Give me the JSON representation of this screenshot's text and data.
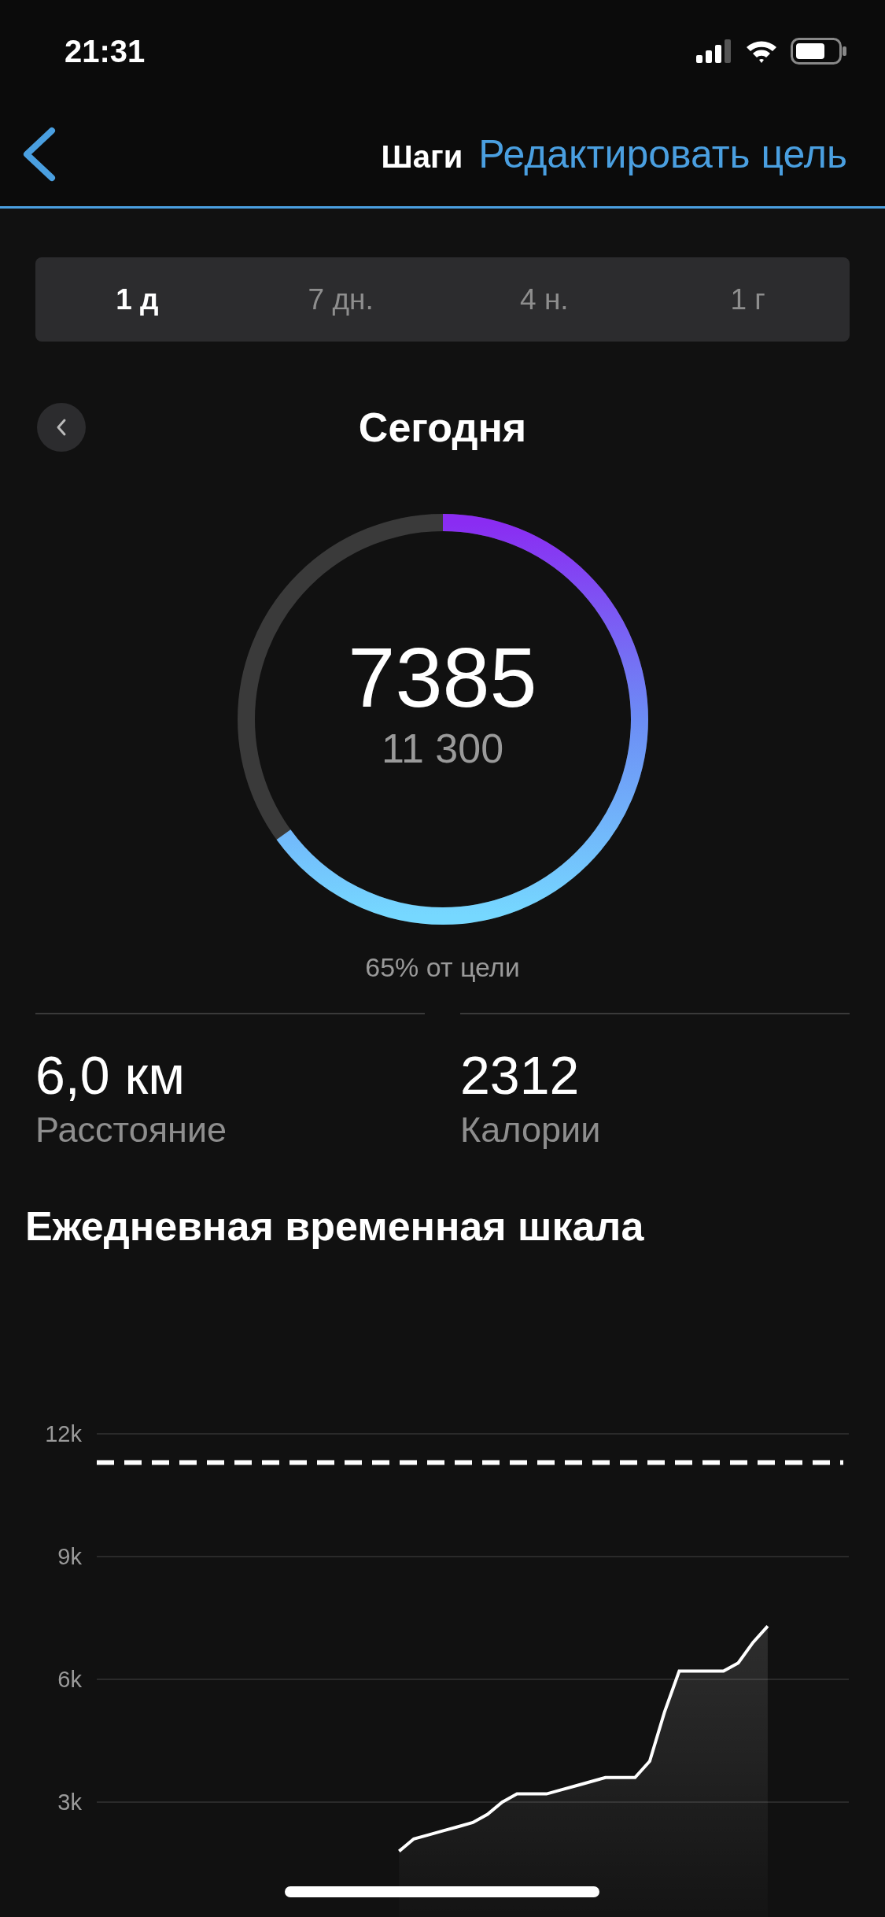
{
  "status_bar": {
    "time": "21:31"
  },
  "nav": {
    "title": "Шаги",
    "action": "Редактировать цель"
  },
  "tabs": [
    {
      "label": "1 д",
      "selected": true
    },
    {
      "label": "7 дн.",
      "selected": false
    },
    {
      "label": "4 н.",
      "selected": false
    },
    {
      "label": "1 г",
      "selected": false
    }
  ],
  "period": {
    "title": "Сегодня"
  },
  "ring": {
    "value": "7385",
    "goal": "11 300",
    "caption": "65% от цели"
  },
  "stats": [
    {
      "value": "6,0 км",
      "label": "Расстояние"
    },
    {
      "value": "2312",
      "label": "Калории"
    }
  ],
  "timeline": {
    "title": "Ежедневная временная шкала",
    "chart_data": {
      "type": "area",
      "ylim": [
        0,
        12000
      ],
      "yticks": [
        {
          "value": 3000,
          "label": "3k"
        },
        {
          "value": 6000,
          "label": "6k"
        },
        {
          "value": 9000,
          "label": "9k"
        },
        {
          "value": 12000,
          "label": "12k"
        }
      ],
      "categories": [
        null,
        null,
        null,
        null,
        null,
        null,
        null,
        null,
        null,
        null,
        null,
        null,
        null,
        null,
        null,
        null,
        null,
        null,
        null,
        null,
        null,
        null,
        null,
        null,
        null,
        null,
        null,
        null,
        null,
        null,
        null,
        null,
        null,
        null,
        null,
        null,
        null,
        null,
        null,
        null,
        null,
        null,
        null,
        null,
        null,
        null,
        null,
        null,
        null,
        null,
        null
      ],
      "values": [
        null,
        null,
        null,
        null,
        null,
        null,
        null,
        null,
        null,
        null,
        null,
        null,
        null,
        null,
        null,
        null,
        null,
        null,
        null,
        null,
        1800,
        2100,
        2200,
        2300,
        2400,
        2500,
        2700,
        3000,
        3200,
        3200,
        3200,
        3300,
        3400,
        3500,
        3600,
        3600,
        3600,
        4000,
        5200,
        6200,
        6200,
        6200,
        6200,
        6400,
        6900,
        7300,
        null,
        null,
        null,
        null,
        null
      ],
      "grid": true,
      "ref_lines": [
        {
          "axis": "y",
          "value": 11300
        }
      ]
    }
  }
}
